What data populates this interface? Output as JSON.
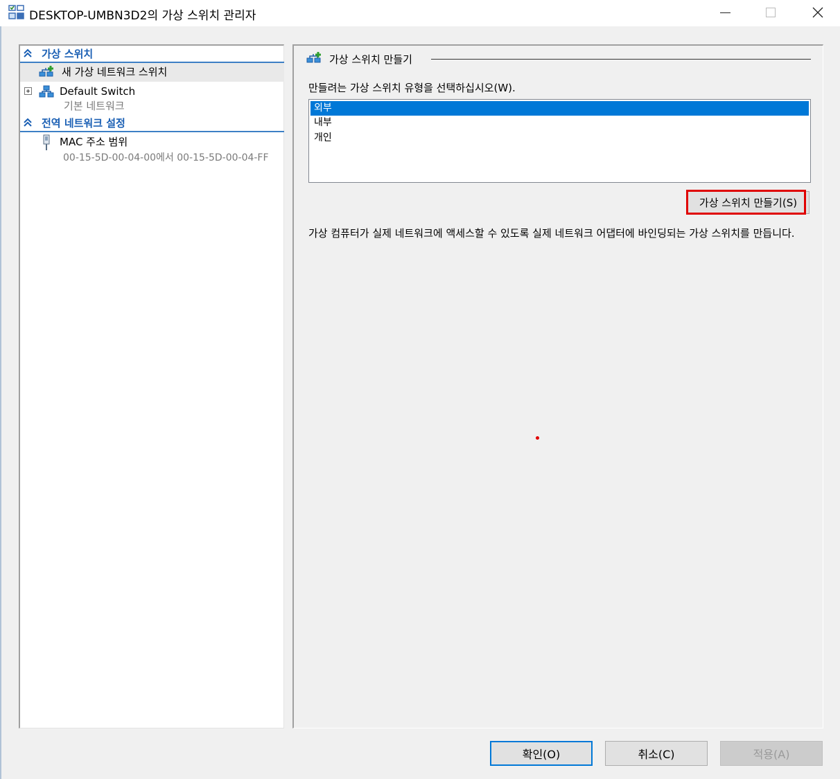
{
  "window": {
    "title": "DESKTOP-UMBN3D2의 가상 스위치 관리자"
  },
  "tree": {
    "virtual_switches_header": "가상 스위치",
    "new_switch_label": "새 가상 네트워크 스위치",
    "default_switch_label": "Default Switch",
    "default_switch_sub": "기본 네트워크",
    "global_header": "전역 네트워크 설정",
    "mac_range_label": "MAC 주소 범위",
    "mac_range_value": "00-15-5D-00-04-00에서 00-15-5D-00-04-FF"
  },
  "content": {
    "group_title": "가상 스위치 만들기",
    "prompt": "만들려는 가상 스위치 유형을 선택하십시오(W).",
    "switch_types": [
      "외부",
      "내부",
      "개인"
    ],
    "selected_type": "외부",
    "create_button": "가상 스위치 만들기(S)",
    "description": "가상 컴퓨터가 실제 네트워크에 액세스할 수 있도록 실제 네트워크 어댑터에 바인딩되는 가상 스위치를 만듭니다."
  },
  "buttons": {
    "ok": "확인(O)",
    "cancel": "취소(C)",
    "apply": "적용(A)"
  },
  "colors": {
    "accent": "#0078d7",
    "section_header": "#1a5fb4",
    "highlight": "#e00000",
    "window_bg": "#f0f0f0"
  },
  "icons": {
    "app": "virtual-switch-manager-icon",
    "new_switch": "network-add-icon",
    "default_switch": "network-switch-icon",
    "mac": "network-adapter-icon",
    "collapse": "double-chevron-up-icon"
  }
}
